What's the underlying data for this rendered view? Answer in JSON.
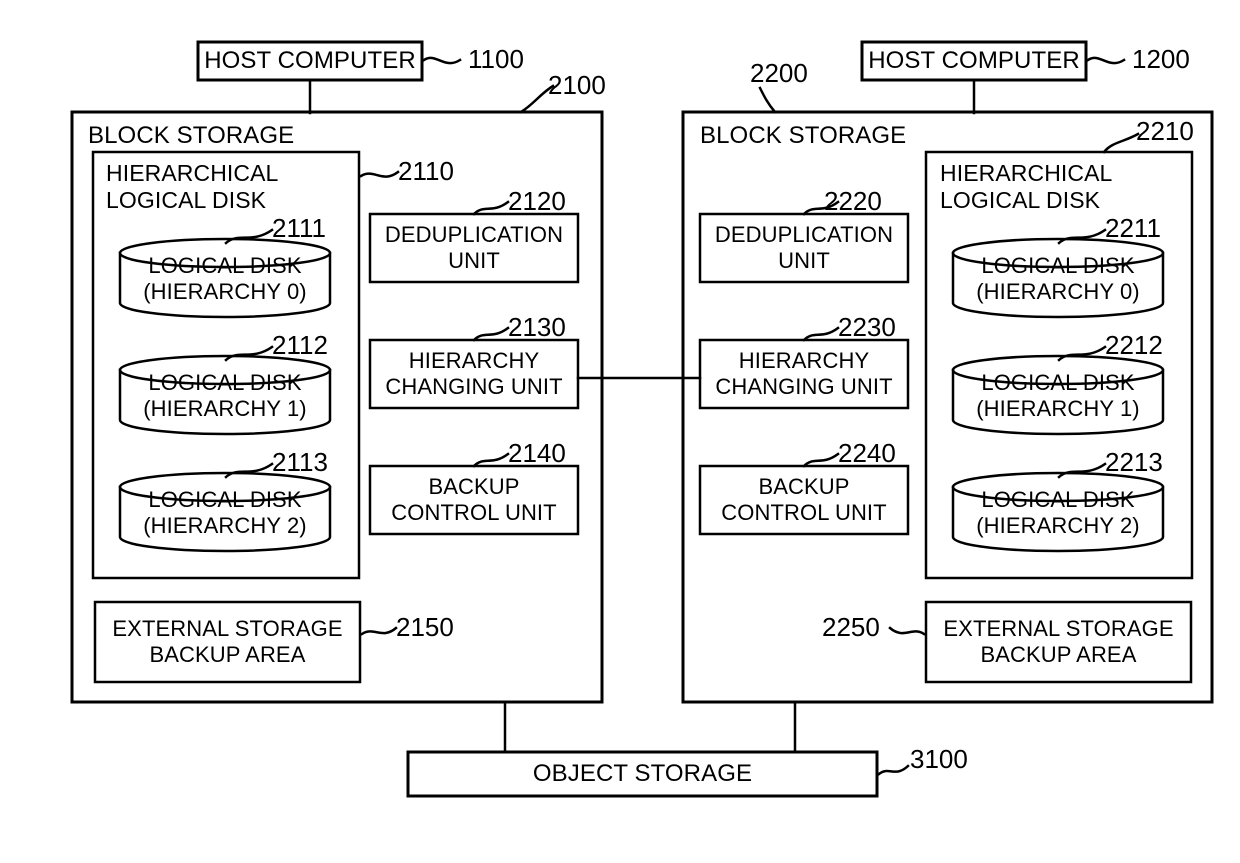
{
  "figure": {
    "type": "patent-block-diagram",
    "background_color": "#ffffff",
    "line_color": "#000000"
  },
  "hosts": [
    {
      "label": "HOST COMPUTER",
      "ref": "1100"
    },
    {
      "label": "HOST COMPUTER",
      "ref": "1200"
    }
  ],
  "block_storage_left": {
    "title": "BLOCK STORAGE",
    "ref": "2100",
    "hierarchical_logical_disk": {
      "title": "HIERARCHICAL\nLOGICAL DISK",
      "ref": "2110",
      "disks": [
        {
          "label": "LOGICAL DISK\n(HIERARCHY 0)",
          "ref": "2111"
        },
        {
          "label": "LOGICAL DISK\n(HIERARCHY 1)",
          "ref": "2112"
        },
        {
          "label": "LOGICAL DISK\n(HIERARCHY 2)",
          "ref": "2113"
        }
      ]
    },
    "units": [
      {
        "label": "DEDUPLICATION\nUNIT",
        "ref": "2120"
      },
      {
        "label": "HIERARCHY\nCHANGING UNIT",
        "ref": "2130"
      },
      {
        "label": "BACKUP\nCONTROL UNIT",
        "ref": "2140"
      }
    ],
    "external_storage_backup_area": {
      "label": "EXTERNAL STORAGE\nBACKUP AREA",
      "ref": "2150"
    }
  },
  "block_storage_right": {
    "title": "BLOCK STORAGE",
    "ref": "2200",
    "hierarchical_logical_disk": {
      "title": "HIERARCHICAL\nLOGICAL DISK",
      "ref": "2210",
      "disks": [
        {
          "label": "LOGICAL DISK\n(HIERARCHY 0)",
          "ref": "2211"
        },
        {
          "label": "LOGICAL DISK\n(HIERARCHY 1)",
          "ref": "2212"
        },
        {
          "label": "LOGICAL DISK\n(HIERARCHY 2)",
          "ref": "2213"
        }
      ]
    },
    "units": [
      {
        "label": "DEDUPLICATION\nUNIT",
        "ref": "2220"
      },
      {
        "label": "HIERARCHY\nCHANGING UNIT",
        "ref": "2230"
      },
      {
        "label": "BACKUP\nCONTROL UNIT",
        "ref": "2240"
      }
    ],
    "external_storage_backup_area": {
      "label": "EXTERNAL STORAGE\nBACKUP AREA",
      "ref": "2250"
    }
  },
  "object_storage": {
    "label": "OBJECT STORAGE",
    "ref": "3100"
  }
}
